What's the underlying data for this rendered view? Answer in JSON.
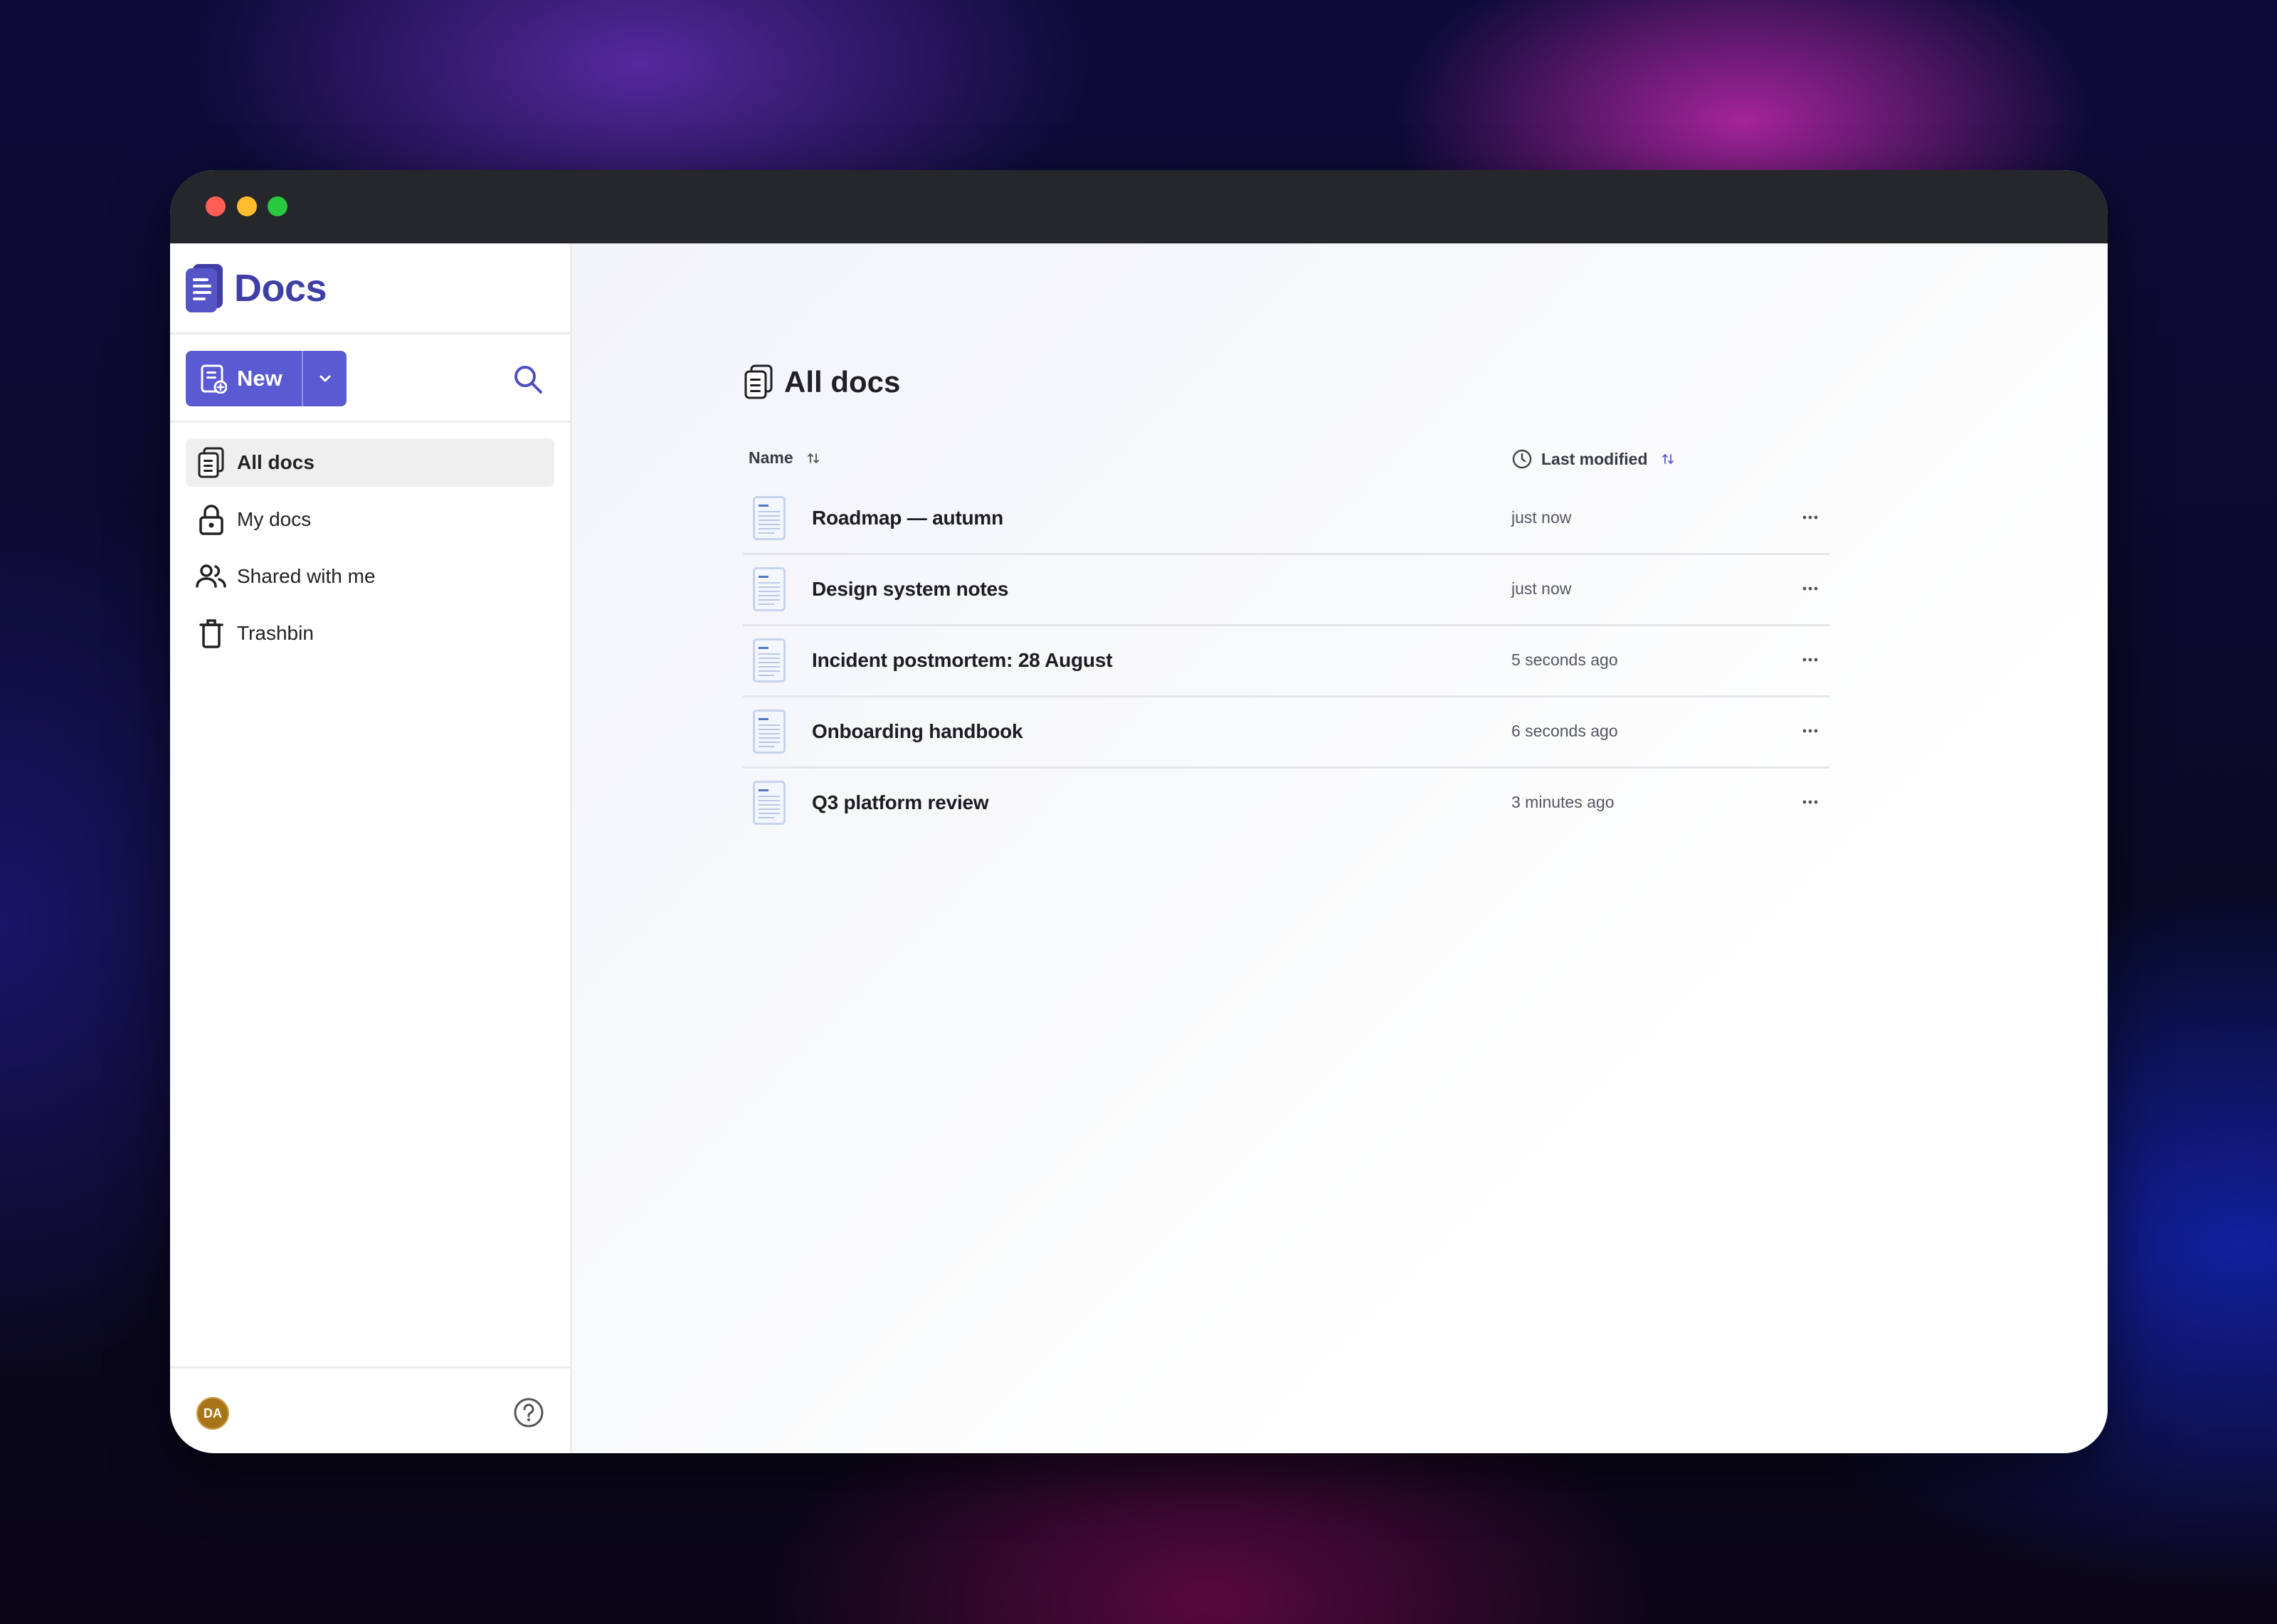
{
  "app": {
    "name": "Docs",
    "accent_color": "#5a5ad2",
    "brand_color": "#3f3fa6"
  },
  "toolbar": {
    "new_label": "New",
    "new_icon": "new-document-icon",
    "dropdown_icon": "chevron-down-icon",
    "search_icon": "search-icon"
  },
  "sidebar": {
    "items": [
      {
        "label": "All docs",
        "icon": "documents-icon",
        "active": true
      },
      {
        "label": "My docs",
        "icon": "lock-icon",
        "active": false
      },
      {
        "label": "Shared with me",
        "icon": "people-icon",
        "active": false
      },
      {
        "label": "Trashbin",
        "icon": "trash-icon",
        "active": false
      }
    ],
    "avatar_initials": "DA",
    "help_icon": "help-icon"
  },
  "main": {
    "title": "All docs",
    "columns": {
      "name": "Name",
      "modified": "Last modified"
    },
    "rows": [
      {
        "name": "Roadmap — autumn",
        "modified": "just now"
      },
      {
        "name": "Design system notes",
        "modified": "just now"
      },
      {
        "name": "Incident postmortem: 28 August",
        "modified": "5 seconds ago"
      },
      {
        "name": "Onboarding handbook",
        "modified": "6 seconds ago"
      },
      {
        "name": "Q3 platform review",
        "modified": "3 minutes ago"
      }
    ]
  }
}
